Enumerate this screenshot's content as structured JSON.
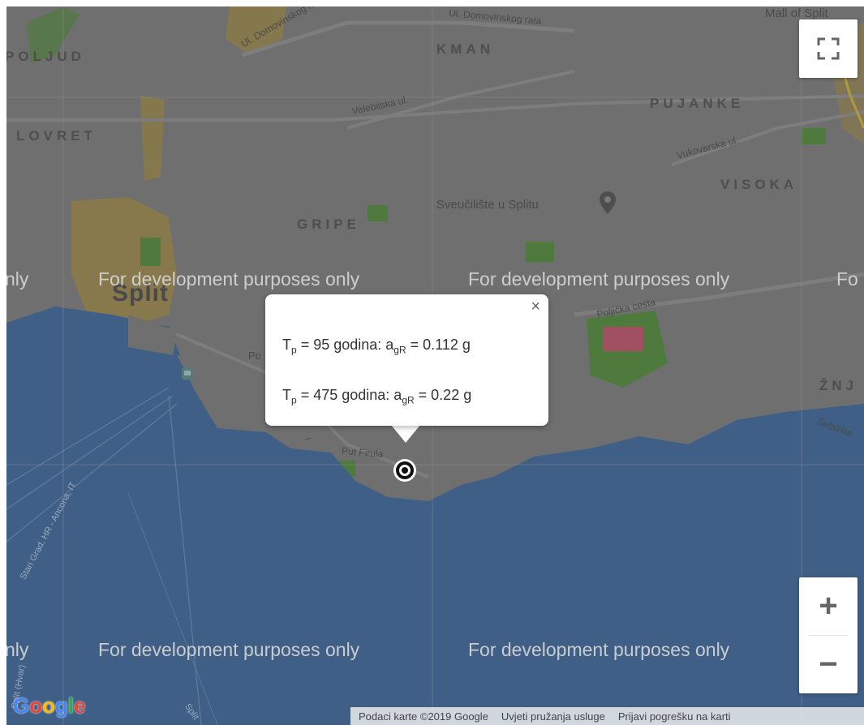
{
  "map": {
    "districts": [
      "POLJUD",
      "LOVRET",
      "KMAN",
      "PUJANKE",
      "VISOKA",
      "GRIPE",
      "ŽNJ"
    ],
    "city": "Split",
    "streets": [
      "Ul. Domovinskog rata",
      "Ul. Domovinskog rata",
      "Velebitska ul.",
      "Vukovarska ul.",
      "Poljička cesta",
      "Put Firula",
      "Šetalište",
      "Mall of Split",
      "Stari Grad, HR - Ancona, IT",
      "Split (Hvar)",
      "Split",
      "Po",
      "i"
    ],
    "poi": "Sveučilište u Splitu",
    "dev_watermark": "For development purposes only",
    "dev_watermark_left_partial": "nly",
    "dev_watermark_right_partial": "Fo",
    "colors": {
      "water": "#3f5f86",
      "land": "#6f6f6f",
      "urban": "#8a7a4a",
      "park": "#4a7a3a"
    }
  },
  "popup": {
    "line1": {
      "T": "T",
      "sub_p": "p",
      "eq": " =  95 godina: a",
      "sub_gR": "gR",
      "val": " = 0.112 g"
    },
    "line2": {
      "T": "T",
      "sub_p": "p",
      "eq": " = 475 godina: a",
      "sub_gR": "gR",
      "val": " = 0.22 g"
    },
    "close_icon": "×"
  },
  "controls": {
    "fullscreen_icon": "fullscreen-icon",
    "zoom_in": "+",
    "zoom_out": "−"
  },
  "footer": {
    "map_data": "Podaci karte ©2019 Google",
    "terms": "Uvjeti pružanja usluge",
    "report": "Prijavi pogrešku na karti"
  },
  "logo": "Google"
}
